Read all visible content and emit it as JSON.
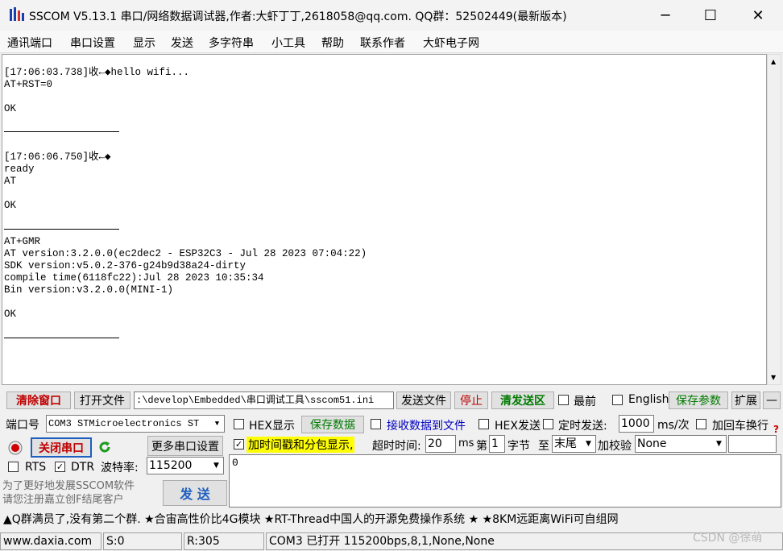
{
  "window": {
    "title": "SSCOM V5.13.1 串口/网络数据调试器,作者:大虾丁丁,2618058@qq.com. QQ群：52502449(最新版本)",
    "minimize": "─",
    "maximize": "☐",
    "close": "✕"
  },
  "menu": [
    "通讯端口",
    "串口设置",
    "显示",
    "发送",
    "多字符串",
    "小工具",
    "帮助",
    "联系作者",
    "大虾电子网"
  ],
  "receive": {
    "lines": [
      "[17:06:03.738]收←◆hello wifi...",
      "AT+RST=0",
      "",
      "OK",
      "",
      "[17:06:06.750]收←◆",
      "ready",
      "AT",
      "",
      "OK",
      "",
      "AT+GMR",
      "AT version:3.2.0.0(ec2dec2 - ESP32C3 - Jul 28 2023 07:04:22)",
      "SDK version:v5.0.2-376-g24b9d38a24-dirty",
      "compile time(6118fc22):Jul 28 2023 10:35:34",
      "Bin version:v3.2.0.0(MINI-1)",
      "",
      "OK"
    ]
  },
  "toolbar1": {
    "clear_window": "清除窗口",
    "open_file": "打开文件",
    "file_path": ":\\develop\\Embedded\\串口调试工具\\sscom51.ini",
    "send_file": "发送文件",
    "stop": "停止",
    "clear_send": "清发送区",
    "top_most": "最前",
    "english": "English",
    "save_params": "保存参数",
    "expand": "扩展",
    "collapse": "—"
  },
  "port": {
    "port_label": "端口号",
    "port_value": "COM3 STMicroelectronics ST",
    "close_port": "关闭串口",
    "more_settings": "更多串口设置",
    "rts": "RTS",
    "dtr": "DTR",
    "baud_label": "波特率:",
    "baud_value": "115200",
    "promo": "为了更好地发展SSCOM软件\n请您注册嘉立创F结尾客户",
    "send": "发 送"
  },
  "options": {
    "hex_display": "HEX显示",
    "save_data": "保存数据",
    "recv_to_file": "接收数据到文件",
    "hex_send": "HEX发送",
    "timed_send": "定时发送:",
    "interval": "1000",
    "interval_unit": "ms/次",
    "add_crlf": "加回车换行",
    "timestamp": "加时间戳和分包显示,",
    "timeout_label": "超时时间:",
    "timeout_value": "20",
    "timeout_unit": "ms",
    "byte_label_pre": "第",
    "byte_value": "1",
    "byte_label_post": "字节",
    "to_label": "至",
    "to_value": "末尾",
    "checksum_label": "加校验",
    "checksum_value": "None"
  },
  "send_area": {
    "text": "0"
  },
  "ad_bar": "▲Q群满员了,没有第二个群. ★合宙高性价比4G模块 ★RT-Thread中国人的开源免费操作系统 ★ ★8KM远距离WiFi可自组网",
  "statusbar": {
    "website": "www.daxia.com",
    "sent": "S:0",
    "received": "R:305",
    "port_status": "COM3 已打开  115200bps,8,1,None,None"
  },
  "watermark": "CSDN @徐萌"
}
